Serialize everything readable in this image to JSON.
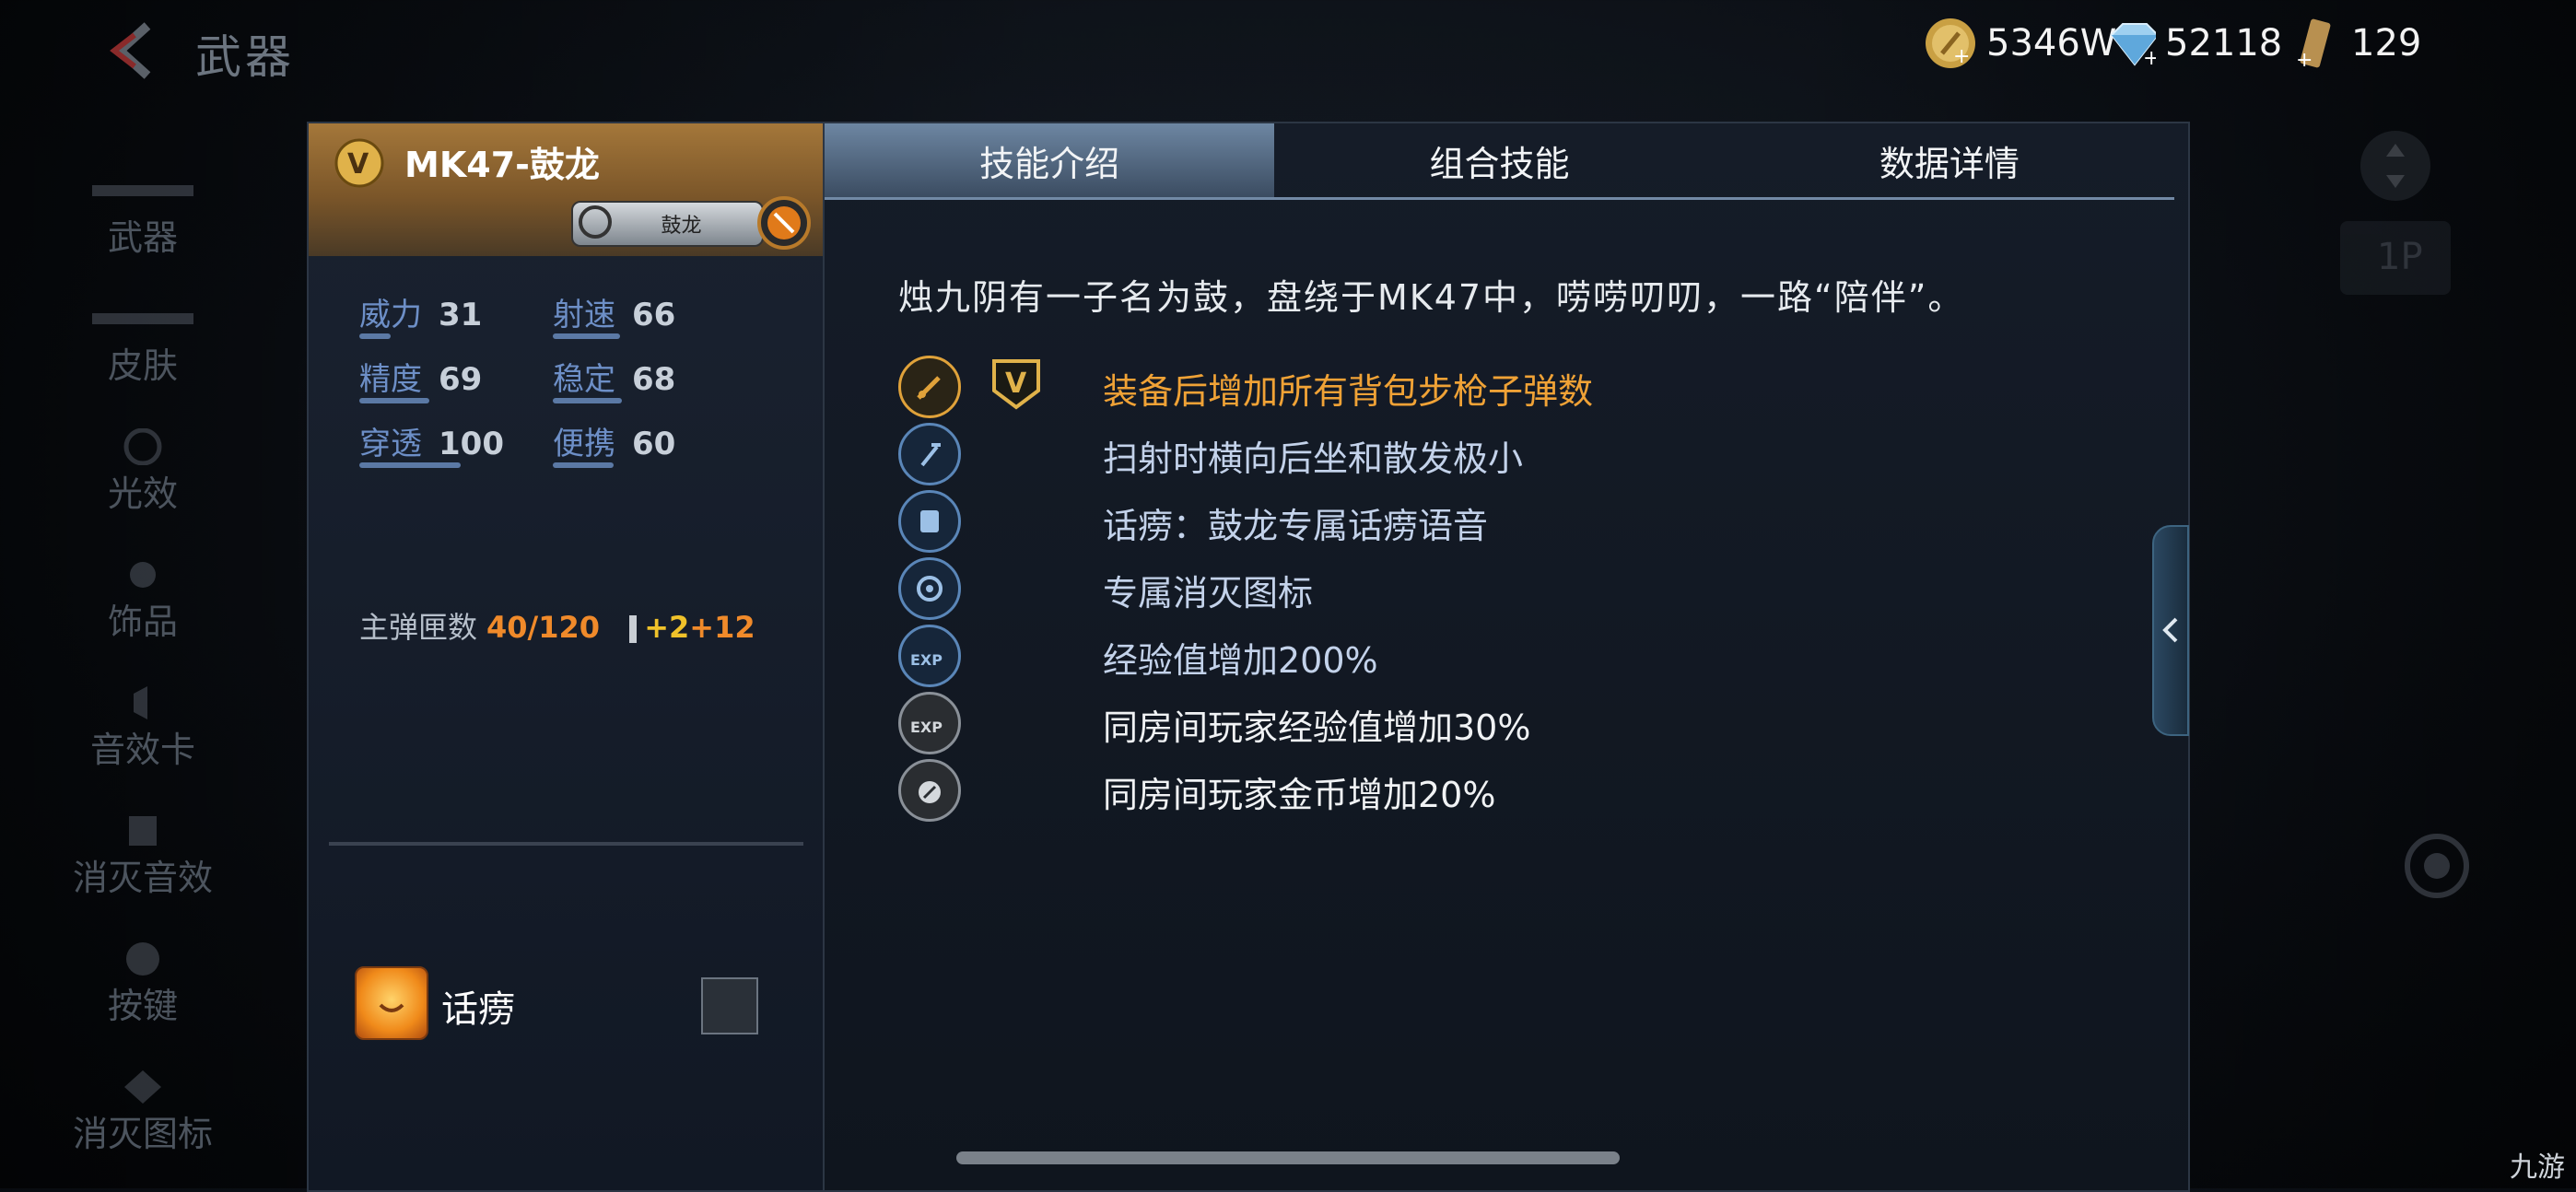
{
  "header": {
    "title": "武器"
  },
  "currencies": [
    {
      "icon": "gold-coin-icon",
      "value": "5346W"
    },
    {
      "icon": "diamond-icon",
      "value": "52118"
    },
    {
      "icon": "ticket-icon",
      "value": "129"
    }
  ],
  "side_nav": [
    "武器",
    "皮肤",
    "光效",
    "饰品",
    "音效卡",
    "消灭音效",
    "按键",
    "消灭图标"
  ],
  "weapon": {
    "name": "MK47-鼓龙",
    "tag": "鼓龙",
    "stats": [
      {
        "label": "威力",
        "value": "31",
        "fraction": 0.31
      },
      {
        "label": "射速",
        "value": "66",
        "fraction": 0.66
      },
      {
        "label": "精度",
        "value": "69",
        "fraction": 0.69
      },
      {
        "label": "稳定",
        "value": "68",
        "fraction": 0.68
      },
      {
        "label": "穿透",
        "value": "100",
        "fraction": 1.0
      },
      {
        "label": "便携",
        "value": "60",
        "fraction": 0.6
      }
    ],
    "ammo": {
      "label": "主弹匣数",
      "value": "40/120",
      "bonus1": "+2",
      "bonus2": "+12"
    },
    "voice": {
      "label": "话痨"
    }
  },
  "tabs": [
    "技能介绍",
    "组合技能",
    "数据详情"
  ],
  "description": "烛九阴有一子名为鼓，盘绕于MK47中，唠唠叨叨，一路“陪伴”。",
  "skills": [
    {
      "icon": "rifle-ammo-icon",
      "text": "装备后增加所有背包步枪子弹数",
      "style": "gold"
    },
    {
      "icon": "recoil-icon",
      "text": "扫射时横向后坐和散发极小",
      "style": "blue"
    },
    {
      "icon": "voice-icon",
      "text": "话痨：鼓龙专属话痨语音",
      "style": "blue"
    },
    {
      "icon": "kill-mark-icon",
      "text": "专属消灭图标",
      "style": "blue"
    },
    {
      "icon": "exp-icon",
      "text": "经验值增加200%",
      "style": "blue"
    },
    {
      "icon": "room-exp-icon",
      "text": "同房间玩家经验值增加30%",
      "style": "white"
    },
    {
      "icon": "room-gold-icon",
      "text": "同房间玩家金币增加20%",
      "style": "white"
    }
  ],
  "watermark": "九游",
  "colors": {
    "gold": "#f0a236",
    "blue_text": "#c3d2ea",
    "orange": "#f08a2a",
    "yellow": "#f0c22a"
  }
}
